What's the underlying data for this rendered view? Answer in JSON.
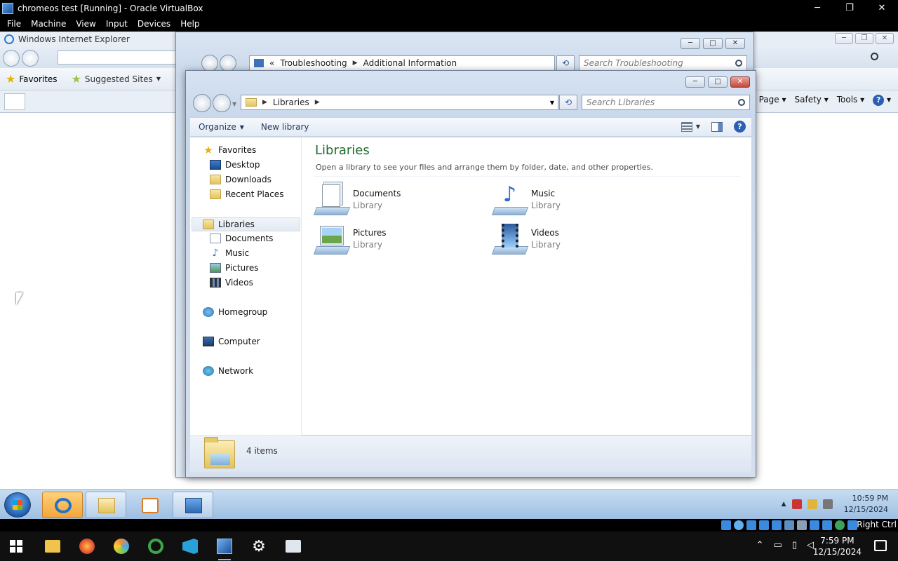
{
  "vbox": {
    "title": "chromeos test [Running] - Oracle VirtualBox",
    "menu": [
      "File",
      "Machine",
      "View",
      "Input",
      "Devices",
      "Help"
    ],
    "window_controls": {
      "minimize": "─",
      "restore": "❐",
      "close": "✕"
    },
    "status_right": "Right Ctrl"
  },
  "ie": {
    "title": "Windows Internet Explorer",
    "favorites_label": "Favorites",
    "suggested_sites_label": "Suggested Sites",
    "commands": [
      "Page",
      "Safety",
      "Tools"
    ],
    "help_glyph": "?"
  },
  "trouble": {
    "breadcrumb": [
      "«",
      "Troubleshooting",
      "Additional Information"
    ],
    "search_placeholder": "Search Troubleshooting"
  },
  "explorer": {
    "breadcrumb": [
      "Libraries"
    ],
    "search_placeholder": "Search Libraries",
    "toolbar": {
      "organize": "Organize",
      "new_library": "New library",
      "help_glyph": "?"
    },
    "nav": {
      "favorites": {
        "label": "Favorites",
        "items": [
          "Desktop",
          "Downloads",
          "Recent Places"
        ]
      },
      "libraries": {
        "label": "Libraries",
        "items": [
          "Documents",
          "Music",
          "Pictures",
          "Videos"
        ]
      },
      "homegroup": "Homegroup",
      "computer": "Computer",
      "network": "Network"
    },
    "content": {
      "heading": "Libraries",
      "description": "Open a library to see your files and arrange them by folder, date, and other properties.",
      "libraries": [
        {
          "name": "Documents",
          "type": "Library",
          "icon": "documents-library-icon"
        },
        {
          "name": "Music",
          "type": "Library",
          "icon": "music-library-icon"
        },
        {
          "name": "Pictures",
          "type": "Library",
          "icon": "pictures-library-icon"
        },
        {
          "name": "Videos",
          "type": "Library",
          "icon": "videos-library-icon"
        }
      ]
    },
    "details": {
      "count": "4 items"
    }
  },
  "guest_taskbar": {
    "clock_time": "10:59 PM",
    "clock_date": "12/15/2024"
  },
  "host_taskbar": {
    "clock_time": "7:59 PM",
    "clock_date": "12/15/2024"
  },
  "colors": {
    "heading_green": "#1e6b2e",
    "vbox_bar": "#000000",
    "win7_taskbar": "#9dbfe2"
  }
}
